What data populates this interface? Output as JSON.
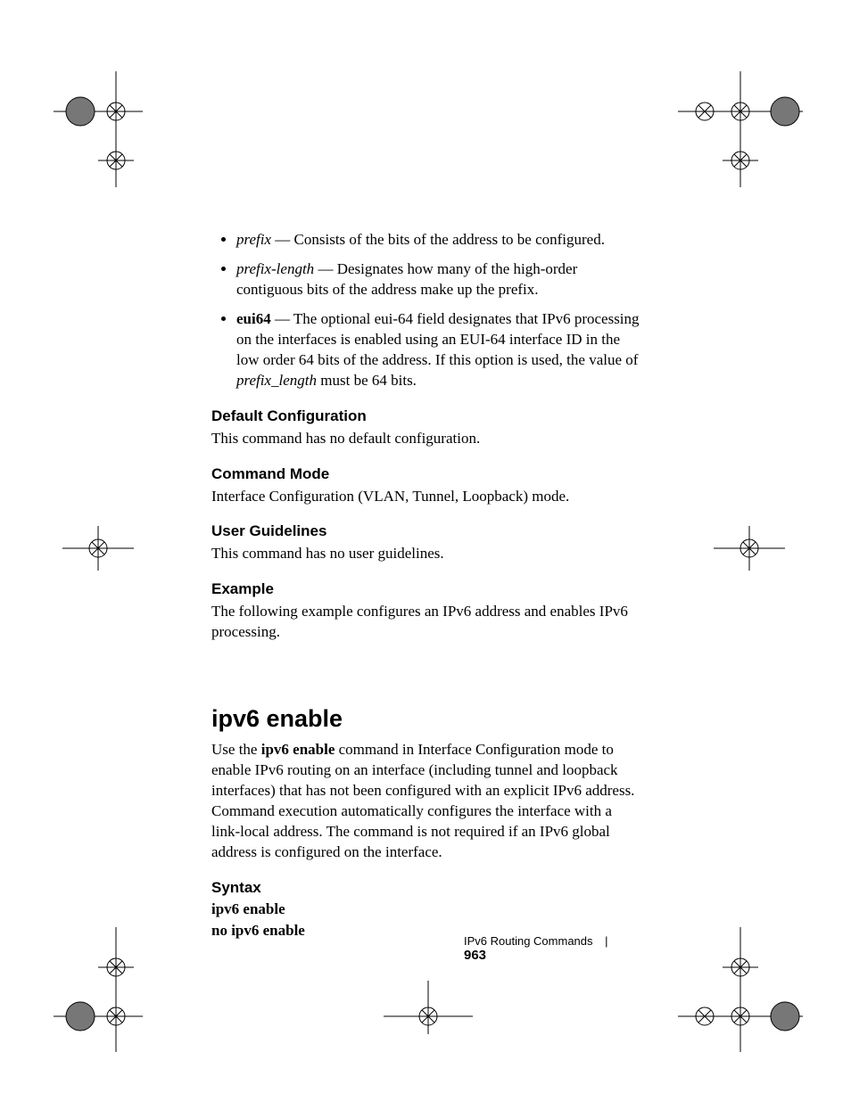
{
  "bullets": [
    {
      "term": "prefix",
      "term_style": "italic",
      "desc": " — Consists of the bits of the address to be configured."
    },
    {
      "term": "prefix-length",
      "term_style": "italic",
      "desc": " — Designates how many of the high-order contiguous bits of the address make up the prefix."
    },
    {
      "term": "eui64",
      "term_style": "bold",
      "desc_pre": " — The optional eui-64 field designates that IPv6 processing on the interfaces is enabled using an EUI-64 interface ID in the low order 64 bits of the address. If this option is used, the value of ",
      "desc_it": "prefix_length",
      "desc_post": " must be 64 bits."
    }
  ],
  "sections": {
    "default_cfg_head": "Default Configuration",
    "default_cfg_body": "This command has no default configuration.",
    "cmd_mode_head": "Command Mode",
    "cmd_mode_body": "Interface Configuration (VLAN, Tunnel, Loopback) mode.",
    "user_guide_head": "User Guidelines",
    "user_guide_body": "This command has no user guidelines.",
    "example_head": "Example",
    "example_body": "The following example configures an IPv6 address and enables IPv6 processing."
  },
  "command": {
    "title": "ipv6 enable",
    "intro_pre": "Use the ",
    "intro_bold": "ipv6 enable",
    "intro_post": " command in Interface Configuration mode to enable IPv6 routing on an interface (including tunnel and loopback interfaces) that has not been configured with an explicit IPv6 address. Command execution automatically configures the interface with a link-local address. The command is not required if an IPv6 global address is configured on the interface.",
    "syntax_head": "Syntax",
    "syntax_lines": [
      "ipv6 enable",
      "no ipv6 enable"
    ]
  },
  "footer": {
    "section": "IPv6 Routing Commands",
    "page": "963"
  }
}
